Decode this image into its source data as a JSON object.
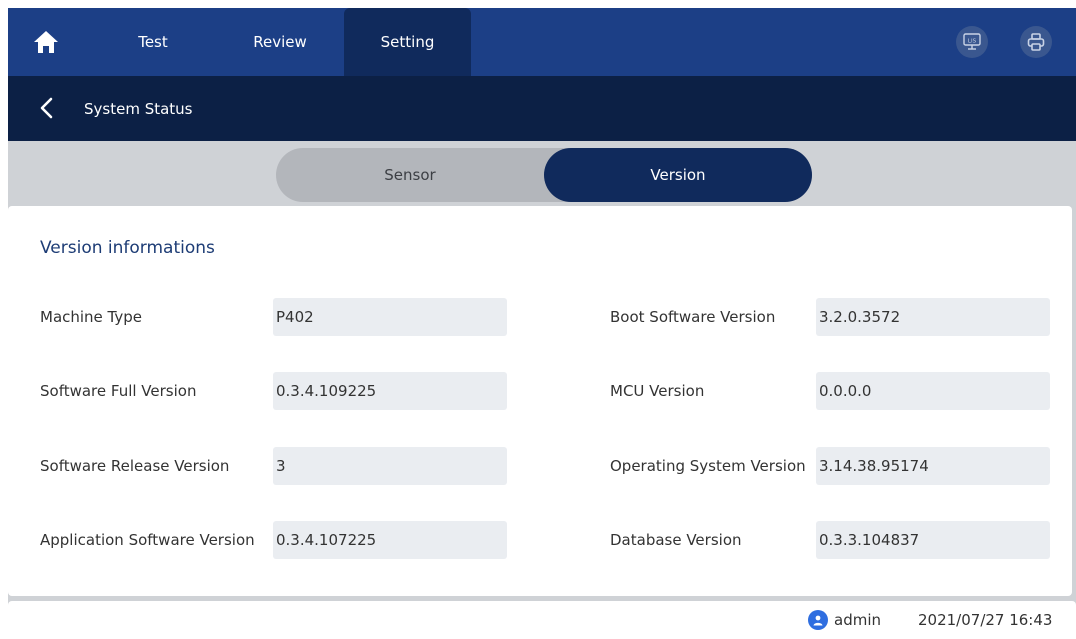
{
  "nav": {
    "tabs": [
      {
        "label": "Test"
      },
      {
        "label": "Review"
      },
      {
        "label": "Setting"
      }
    ],
    "active_tab": "Setting",
    "icons": [
      "home-icon",
      "lis-monitor-icon",
      "printer-icon"
    ],
    "lis_label": "LIS"
  },
  "header": {
    "title": "System Status"
  },
  "segment": {
    "options": [
      "Sensor",
      "Version"
    ],
    "selected": "Version"
  },
  "version_panel": {
    "title": "Version informations",
    "left": [
      {
        "label": "Machine Type",
        "value": "P402"
      },
      {
        "label": "Software Full Version",
        "value": "0.3.4.109225"
      },
      {
        "label": "Software Release Version",
        "value": "3"
      },
      {
        "label": "Application Software Version",
        "value": "0.3.4.107225"
      }
    ],
    "right": [
      {
        "label": "Boot Software  Version",
        "value": "3.2.0.3572"
      },
      {
        "label": "MCU Version",
        "value": "0.0.0.0"
      },
      {
        "label": "Operating System Version",
        "value": "3.14.38.95174"
      },
      {
        "label": "Database Version",
        "value": "0.3.3.104837"
      }
    ]
  },
  "footer": {
    "user": "admin",
    "datetime": "2021/07/27 16:43"
  },
  "colors": {
    "nav_bg": "#1c3f86",
    "nav_active": "#102a5c",
    "subheader_bg": "#0c2045",
    "field_bg": "#eaedf1",
    "title_color": "#1d3c75",
    "user_icon": "#2f6ee0"
  }
}
